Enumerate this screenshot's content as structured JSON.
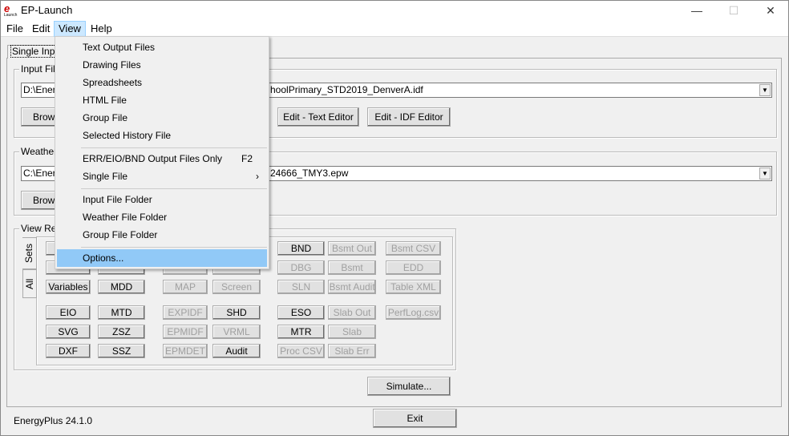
{
  "window": {
    "title": "EP-Launch",
    "logo_text": "e",
    "logo_sub": "Launch",
    "minimize": "—",
    "maximize": "☐",
    "close": "✕"
  },
  "menubar": {
    "items": [
      "File",
      "Edit",
      "View",
      "Help"
    ],
    "active": "View"
  },
  "tab": {
    "label": "Single Input"
  },
  "input_file": {
    "label": "Input File",
    "value_left": "D:\\Ener",
    "value_right": "hoolPrimary_STD2019_DenverA.idf",
    "browse": "Browse...",
    "edit_text": "Edit - Text Editor",
    "edit_idf": "Edit - IDF Editor"
  },
  "weather_file": {
    "label": "Weather File",
    "value_left": "C:\\Ener",
    "value_right": "24666_TMY3.epw",
    "browse": "Browse..."
  },
  "view_results": {
    "label": "View Results",
    "tabs": [
      "Sets",
      "All"
    ],
    "rows": [
      [
        {
          "l": "",
          "e": true
        },
        {
          "l": "",
          "e": true
        },
        {
          "l": "",
          "e": false
        },
        {
          "l": "",
          "e": false
        },
        {
          "l": "BND",
          "e": true
        },
        {
          "l": "Bsmt Out",
          "e": false
        },
        {
          "l": "Bsmt CSV",
          "e": false
        }
      ],
      [
        {
          "l": "",
          "e": true
        },
        {
          "l": "",
          "e": true
        },
        {
          "l": "",
          "e": false
        },
        {
          "l": "",
          "e": false
        },
        {
          "l": "DBG",
          "e": false
        },
        {
          "l": "Bsmt",
          "e": false
        },
        {
          "l": "EDD",
          "e": false
        }
      ],
      [
        {
          "l": "Variables",
          "e": true
        },
        {
          "l": "MDD",
          "e": true
        },
        {
          "l": "MAP",
          "e": false
        },
        {
          "l": "Screen",
          "e": false
        },
        {
          "l": "SLN",
          "e": false
        },
        {
          "l": "Bsmt Audit",
          "e": false
        },
        {
          "l": "Table XML",
          "e": false
        }
      ],
      [
        {
          "l": "EIO",
          "e": true
        },
        {
          "l": "MTD",
          "e": true
        },
        {
          "l": "EXPIDF",
          "e": false
        },
        {
          "l": "SHD",
          "e": true
        },
        {
          "l": "ESO",
          "e": true
        },
        {
          "l": "Slab Out",
          "e": false
        },
        {
          "l": "PerfLog.csv",
          "e": false
        }
      ],
      [
        {
          "l": "SVG",
          "e": true
        },
        {
          "l": "ZSZ",
          "e": true
        },
        {
          "l": "EPMIDF",
          "e": false
        },
        {
          "l": "VRML",
          "e": false
        },
        {
          "l": "MTR",
          "e": true
        },
        {
          "l": "Slab",
          "e": false
        },
        null
      ],
      [
        {
          "l": "DXF",
          "e": true
        },
        {
          "l": "SSZ",
          "e": true
        },
        {
          "l": "EPMDET",
          "e": false
        },
        {
          "l": "Audit",
          "e": true
        },
        {
          "l": "Proc CSV",
          "e": false
        },
        {
          "l": "Slab Err",
          "e": false
        },
        null
      ]
    ]
  },
  "simulate": "Simulate...",
  "exit": "Exit",
  "version": "EnergyPlus 24.1.0",
  "view_menu": {
    "items": [
      {
        "label": "Text Output Files"
      },
      {
        "label": "Drawing Files"
      },
      {
        "label": "Spreadsheets"
      },
      {
        "label": "HTML File"
      },
      {
        "label": "Group File"
      },
      {
        "label": "Selected History File"
      },
      {
        "label": "ERR/EIO/BND Output Files Only",
        "shortcut": "F2"
      },
      {
        "label": "Single File",
        "submenu": "›"
      },
      {
        "label": "Input File Folder"
      },
      {
        "label": "Weather File Folder"
      },
      {
        "label": "Group File Folder"
      },
      {
        "label": "Options...",
        "highlighted": true
      }
    ]
  },
  "colors": {
    "highlight": "#91c9f7",
    "menu_active": "#cce8ff",
    "disabled_text": "#a0a0a0"
  }
}
